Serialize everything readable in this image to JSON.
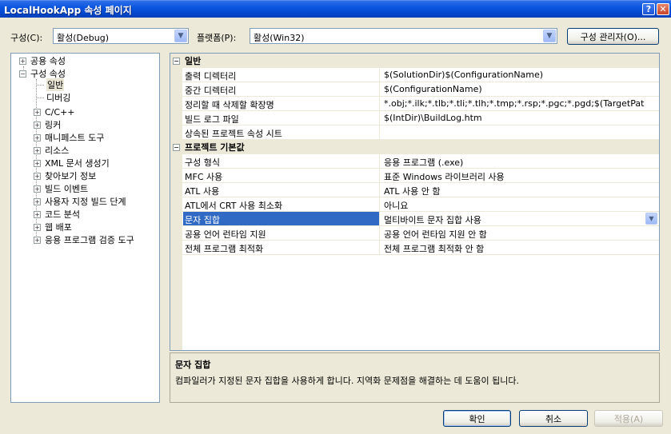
{
  "window": {
    "title": "LocalHookApp 속성 페이지",
    "help_button": "?",
    "close_button": "✕"
  },
  "top": {
    "config_label": "구성(C):",
    "config_value": "활성(Debug)",
    "platform_label": "플랫폼(P):",
    "platform_value": "활성(Win32)",
    "config_manager_button": "구성 관리자(O)..."
  },
  "tree": {
    "common_props": "공용 속성",
    "config_props": "구성 속성",
    "items": {
      "general": "일반",
      "debugging": "디버깅",
      "cpp": "C/C++",
      "linker": "링커",
      "manifest": "매니페스트 도구",
      "resources": "리소스",
      "xml": "XML 문서 생성기",
      "browse": "찾아보기 정보",
      "build_events": "빌드 이벤트",
      "custom_build": "사용자 지정 빌드 단계",
      "code_analysis": "코드 분석",
      "web_deploy": "웹 배포",
      "app_verifier": "응용 프로그램 검증 도구"
    }
  },
  "grid": {
    "cat_general": "일반",
    "cat_defaults": "프로젝트 기본값",
    "rows": [
      {
        "name": "출력 디렉터리",
        "value": "$(SolutionDir)$(ConfigurationName)"
      },
      {
        "name": "중간 디렉터리",
        "value": "$(ConfigurationName)"
      },
      {
        "name": "정리할 때 삭제할 확장명",
        "value": "*.obj;*.ilk;*.tlb;*.tli;*.tlh;*.tmp;*.rsp;*.pgc;*.pgd;$(TargetPat"
      },
      {
        "name": "빌드 로그 파일",
        "value": "$(IntDir)\\BuildLog.htm"
      },
      {
        "name": "상속된 프로젝트 속성 시트",
        "value": ""
      }
    ],
    "rows2": [
      {
        "name": "구성 형식",
        "value": "응용 프로그램 (.exe)"
      },
      {
        "name": "MFC 사용",
        "value": "표준 Windows 라이브러리 사용"
      },
      {
        "name": "ATL 사용",
        "value": "ATL 사용 안 함"
      },
      {
        "name": "ATL에서 CRT 사용 최소화",
        "value": "아니요"
      },
      {
        "name": "문자 집합",
        "value": "멀티바이트 문자 집합 사용"
      },
      {
        "name": "공용 언어 런타임 지원",
        "value": "공용 언어 런타임 지원 안 함"
      },
      {
        "name": "전체 프로그램 최적화",
        "value": "전체 프로그램 최적화 안 함"
      }
    ]
  },
  "description": {
    "title": "문자 집합",
    "text": "컴파일러가 지정된 문자 집합을 사용하게 합니다. 지역화 문제점을 해결하는 데 도움이 됩니다."
  },
  "buttons": {
    "ok": "확인",
    "cancel": "취소",
    "apply": "적용(A)"
  }
}
